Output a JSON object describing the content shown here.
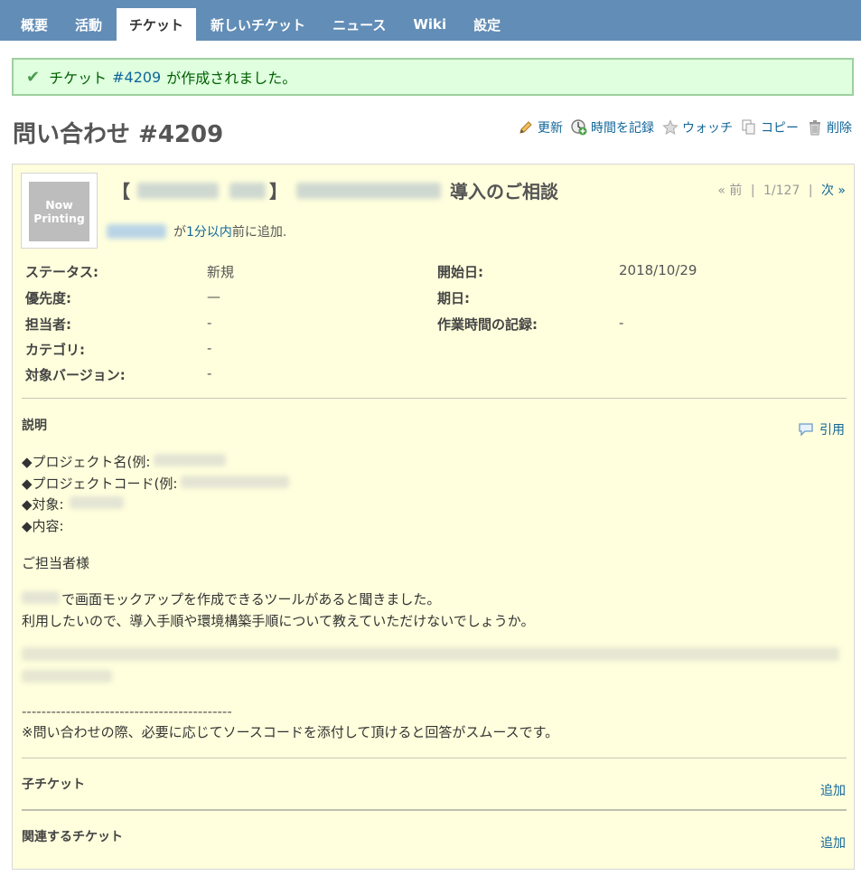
{
  "tabs": [
    {
      "label": "概要",
      "active": false
    },
    {
      "label": "活動",
      "active": false
    },
    {
      "label": "チケット",
      "active": true
    },
    {
      "label": "新しいチケット",
      "active": false
    },
    {
      "label": "ニュース",
      "active": false
    },
    {
      "label": "Wiki",
      "active": false
    },
    {
      "label": "設定",
      "active": false
    }
  ],
  "flash": {
    "prefix": "チケット",
    "link": "#4209",
    "suffix": "が作成されました。"
  },
  "page": {
    "title": "問い合わせ #4209"
  },
  "actions": {
    "edit": "更新",
    "log_time": "時間を記録",
    "watch": "ウォッチ",
    "copy": "コピー",
    "delete": "削除"
  },
  "issue": {
    "avatar_text_1": "Now",
    "avatar_text_2": "Printing",
    "subject_open": "【",
    "subject_close": "】",
    "subject_tail": "導入のご相談",
    "nav_prev": "« 前",
    "nav_count": "1/127",
    "nav_next": "次 »",
    "author_prefix": "が",
    "author_time": "1分以内",
    "author_suffix": "前に追加."
  },
  "attributes": {
    "status_label": "ステータス:",
    "status_value": "新規",
    "priority_label": "優先度:",
    "priority_value": "—",
    "assignee_label": "担当者:",
    "assignee_value": "-",
    "category_label": "カテゴリ:",
    "category_value": "-",
    "version_label": "対象バージョン:",
    "version_value": "-",
    "start_label": "開始日:",
    "start_value": "2018/10/29",
    "due_label": "期日:",
    "due_value": "",
    "spent_label": "作業時間の記録:",
    "spent_value": "-"
  },
  "description": {
    "title": "説明",
    "quote": "引用",
    "line1": "◆プロジェクト名(例:",
    "line2": "◆プロジェクトコード(例:",
    "line3": "◆対象:",
    "line4": "◆内容:",
    "greeting": "ご担当者様",
    "body1": "で画面モックアップを作成できるツールがあると聞きました。",
    "body2": "利用したいので、導入手順や環境構築手順について教えていただけないでしょうか。",
    "dashes": "-------------------------------------------",
    "note": "※問い合わせの際、必要に応じてソースコードを添付して頂けると回答がスムースです。"
  },
  "subtasks": {
    "title": "子チケット",
    "add": "追加"
  },
  "relations": {
    "title": "関連するチケット",
    "add": "追加"
  }
}
